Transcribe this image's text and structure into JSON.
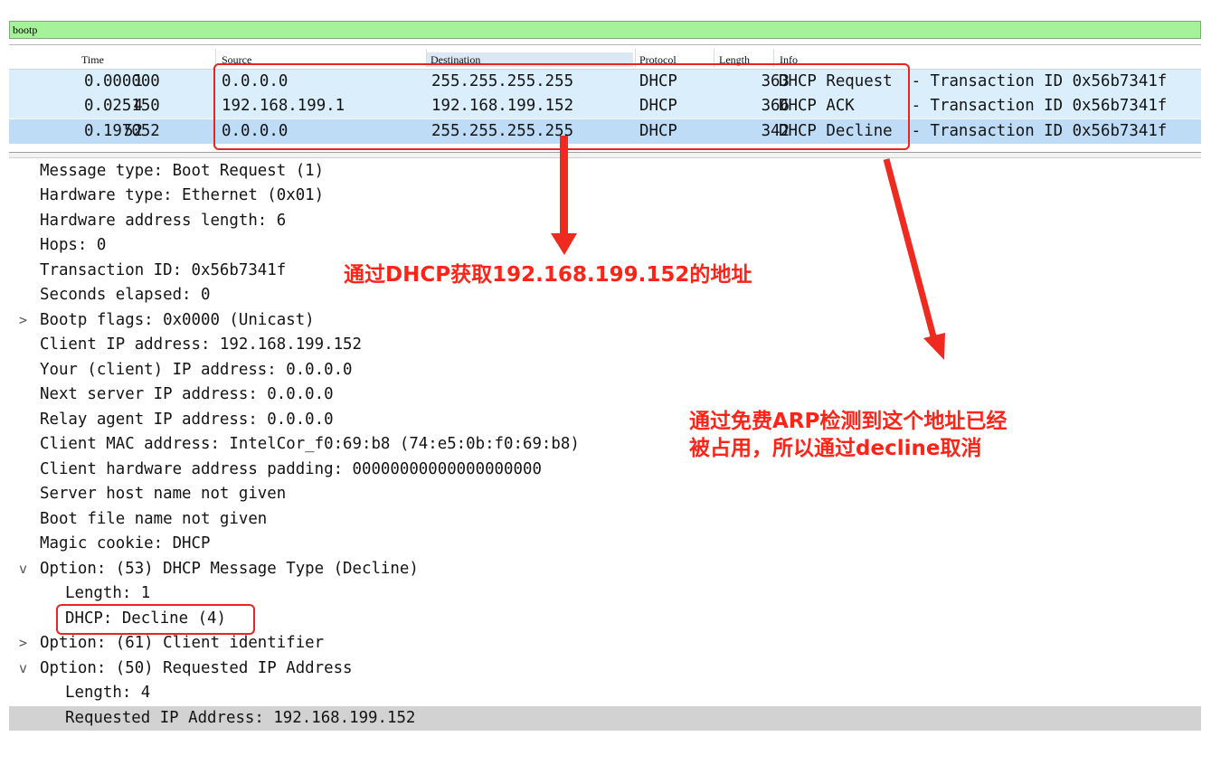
{
  "filter": {
    "value": "bootp"
  },
  "columns": {
    "time": "Time",
    "source": "Source",
    "destination": "Destination",
    "protocol": "Protocol",
    "length": "Length",
    "info": "Info"
  },
  "packets": [
    {
      "no": "1",
      "time": "0.000000",
      "source": "0.0.0.0",
      "destination": "255.255.255.255",
      "protocol": "DHCP",
      "length": "363",
      "info": "DHCP Request  - Transaction ID 0x56b7341f"
    },
    {
      "no": "4",
      "time": "0.025150",
      "source": "192.168.199.1",
      "destination": "192.168.199.152",
      "protocol": "DHCP",
      "length": "366",
      "info": "DHCP ACK      - Transaction ID 0x56b7341f"
    },
    {
      "no": "52",
      "time": "0.197052",
      "source": "0.0.0.0",
      "destination": "255.255.255.255",
      "protocol": "DHCP",
      "length": "342",
      "info": "DHCP Decline  - Transaction ID 0x56b7341f"
    }
  ],
  "details": [
    {
      "text": "Message type: Boot Request (1)",
      "expander": ""
    },
    {
      "text": "Hardware type: Ethernet (0x01)",
      "expander": ""
    },
    {
      "text": "Hardware address length: 6",
      "expander": ""
    },
    {
      "text": "Hops: 0",
      "expander": ""
    },
    {
      "text": "Transaction ID: 0x56b7341f",
      "expander": ""
    },
    {
      "text": "Seconds elapsed: 0",
      "expander": ""
    },
    {
      "text": "Bootp flags: 0x0000 (Unicast)",
      "expander": ">"
    },
    {
      "text": "Client IP address: 192.168.199.152",
      "expander": ""
    },
    {
      "text": "Your (client) IP address: 0.0.0.0",
      "expander": ""
    },
    {
      "text": "Next server IP address: 0.0.0.0",
      "expander": ""
    },
    {
      "text": "Relay agent IP address: 0.0.0.0",
      "expander": ""
    },
    {
      "text": "Client MAC address: IntelCor_f0:69:b8 (74:e5:0b:f0:69:b8)",
      "expander": ""
    },
    {
      "text": "Client hardware address padding: 00000000000000000000",
      "expander": ""
    },
    {
      "text": "Server host name not given",
      "expander": ""
    },
    {
      "text": "Boot file name not given",
      "expander": ""
    },
    {
      "text": "Magic cookie: DHCP",
      "expander": ""
    },
    {
      "text": "Option: (53) DHCP Message Type (Decline)",
      "expander": "v"
    },
    {
      "text": "Length: 1",
      "expander": ""
    },
    {
      "text": "DHCP: Decline (4)",
      "expander": ""
    },
    {
      "text": "Option: (61) Client identifier",
      "expander": ">"
    },
    {
      "text": "Option: (50) Requested IP Address",
      "expander": "v"
    },
    {
      "text": "Length: 4",
      "expander": ""
    },
    {
      "text": "Requested IP Address: 192.168.199.152",
      "expander": ""
    }
  ],
  "annotations": {
    "dhcp_got": "通过DHCP获取192.168.199.152的地址",
    "arp_line1": "通过免费ARP检测到这个地址已经",
    "arp_line2": "被占用，所以通过decline取消"
  },
  "colors": {
    "filter_bg": "#a6f29a",
    "row_bg": "#daeefc",
    "row_selected_bg": "#bedcf6",
    "annotation_red": "#ff2318",
    "detail_selected_bg": "#d2d2d2"
  }
}
